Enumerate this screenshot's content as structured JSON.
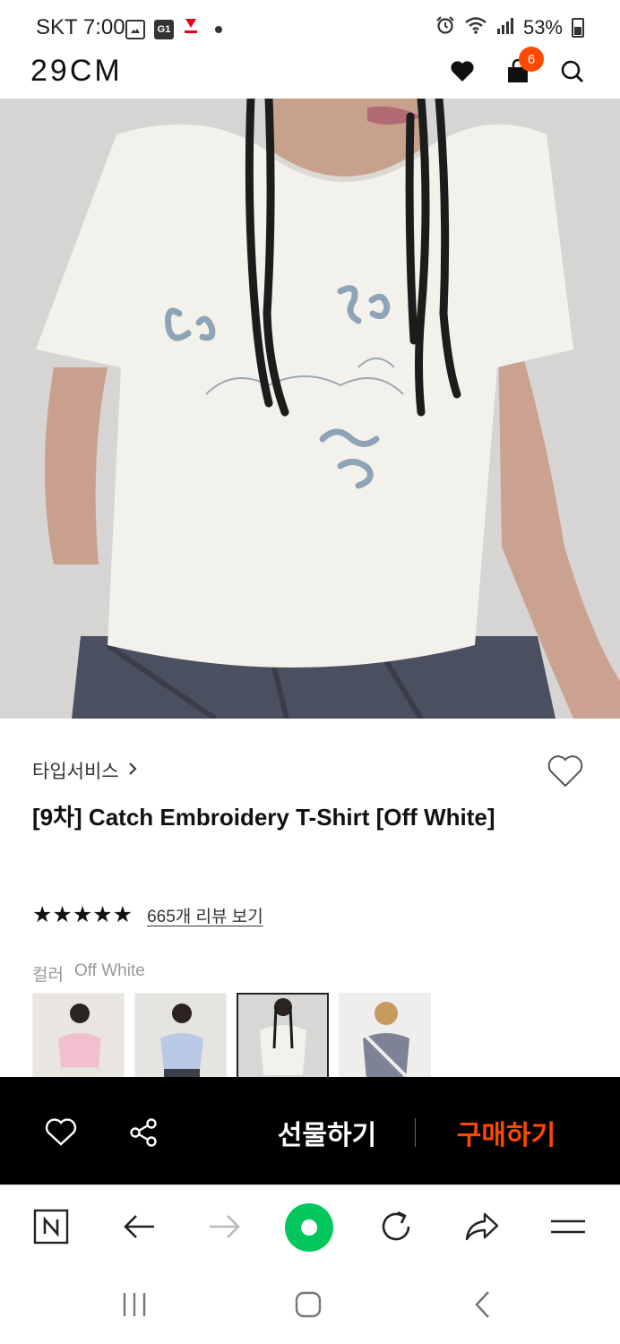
{
  "status_bar": {
    "carrier_time": "SKT 7:00",
    "notif_icons": [
      "gallery-icon",
      "g1-app-icon",
      "deal-app-icon"
    ],
    "g1_label": "G1",
    "battery": "53%"
  },
  "header": {
    "logo": "29CM",
    "cart_count": "6"
  },
  "product": {
    "brand": "타입서비스",
    "title": "[9차] Catch Embroidery T-Shirt [Off White]",
    "stars": "★★★★★",
    "review_link": "665개 리뷰 보기",
    "color_label": "컬러",
    "color_value": "Off White",
    "swatches": [
      {
        "name": "pink",
        "selected": false
      },
      {
        "name": "sky-blue",
        "selected": false
      },
      {
        "name": "off-white",
        "selected": true
      },
      {
        "name": "grey-layered",
        "selected": false
      }
    ]
  },
  "action_bar": {
    "gift_label": "선물하기",
    "buy_label": "구매하기"
  },
  "colors": {
    "accent": "#ff4800",
    "action_bar_bg": "#000000",
    "naver_green": "#03c75a"
  }
}
